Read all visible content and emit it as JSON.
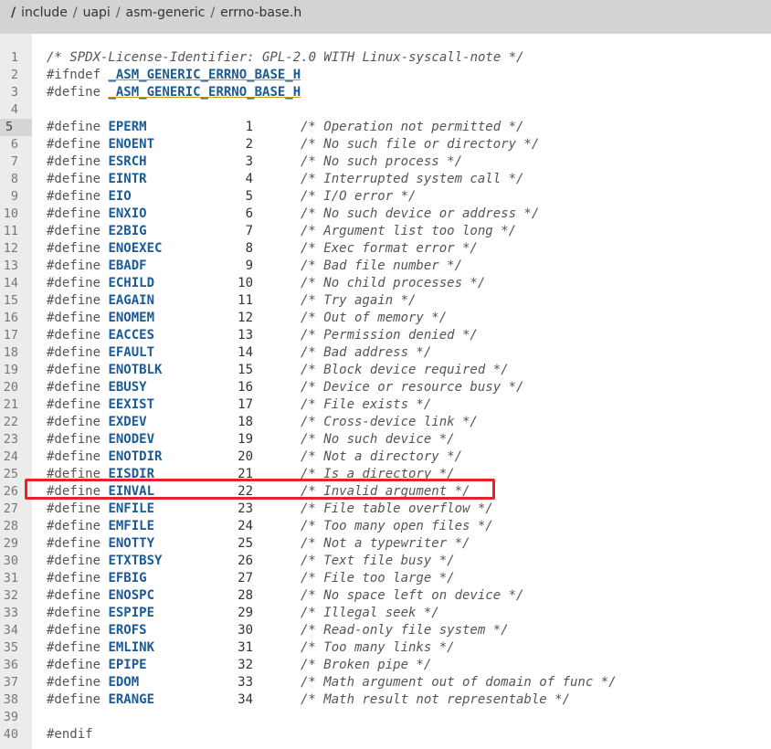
{
  "breadcrumb": {
    "root": "/",
    "items": [
      "include",
      "uapi",
      "asm-generic",
      "errno-base.h"
    ]
  },
  "colors": {
    "topbar": "#d3d3d3",
    "macro": "#1a5a96",
    "highlight_border": "#e8222a"
  },
  "code": {
    "header_lines": [
      {
        "n": "1",
        "text": "/* SPDX-License-Identifier: GPL-2.0 WITH Linux-syscall-note */"
      },
      {
        "n": "2",
        "kw": "#ifndef ",
        "macro": "_ASM_GENERIC_ERRNO_BASE_H"
      },
      {
        "n": "3",
        "kw": "#define ",
        "macro": "_ASM_GENERIC_ERRNO_BASE_H"
      },
      {
        "n": "4"
      }
    ],
    "defines": [
      {
        "n": "5",
        "name": "EPERM",
        "value": "1",
        "comment": "/* Operation not permitted */"
      },
      {
        "n": "6",
        "name": "ENOENT",
        "value": "2",
        "comment": "/* No such file or directory */"
      },
      {
        "n": "7",
        "name": "ESRCH",
        "value": "3",
        "comment": "/* No such process */"
      },
      {
        "n": "8",
        "name": "EINTR",
        "value": "4",
        "comment": "/* Interrupted system call */"
      },
      {
        "n": "9",
        "name": "EIO",
        "value": "5",
        "comment": "/* I/O error */"
      },
      {
        "n": "10",
        "name": "ENXIO",
        "value": "6",
        "comment": "/* No such device or address */"
      },
      {
        "n": "11",
        "name": "E2BIG",
        "value": "7",
        "comment": "/* Argument list too long */"
      },
      {
        "n": "12",
        "name": "ENOEXEC",
        "value": "8",
        "comment": "/* Exec format error */"
      },
      {
        "n": "13",
        "name": "EBADF",
        "value": "9",
        "comment": "/* Bad file number */"
      },
      {
        "n": "14",
        "name": "ECHILD",
        "value": "10",
        "comment": "/* No child processes */"
      },
      {
        "n": "15",
        "name": "EAGAIN",
        "value": "11",
        "comment": "/* Try again */"
      },
      {
        "n": "16",
        "name": "ENOMEM",
        "value": "12",
        "comment": "/* Out of memory */"
      },
      {
        "n": "17",
        "name": "EACCES",
        "value": "13",
        "comment": "/* Permission denied */"
      },
      {
        "n": "18",
        "name": "EFAULT",
        "value": "14",
        "comment": "/* Bad address */"
      },
      {
        "n": "19",
        "name": "ENOTBLK",
        "value": "15",
        "comment": "/* Block device required */"
      },
      {
        "n": "20",
        "name": "EBUSY",
        "value": "16",
        "comment": "/* Device or resource busy */"
      },
      {
        "n": "21",
        "name": "EEXIST",
        "value": "17",
        "comment": "/* File exists */"
      },
      {
        "n": "22",
        "name": "EXDEV",
        "value": "18",
        "comment": "/* Cross-device link */"
      },
      {
        "n": "23",
        "name": "ENODEV",
        "value": "19",
        "comment": "/* No such device */"
      },
      {
        "n": "24",
        "name": "ENOTDIR",
        "value": "20",
        "comment": "/* Not a directory */"
      },
      {
        "n": "25",
        "name": "EISDIR",
        "value": "21",
        "comment": "/* Is a directory */"
      },
      {
        "n": "26",
        "name": "EINVAL",
        "value": "22",
        "comment": "/* Invalid argument */"
      },
      {
        "n": "27",
        "name": "ENFILE",
        "value": "23",
        "comment": "/* File table overflow */"
      },
      {
        "n": "28",
        "name": "EMFILE",
        "value": "24",
        "comment": "/* Too many open files */"
      },
      {
        "n": "29",
        "name": "ENOTTY",
        "value": "25",
        "comment": "/* Not a typewriter */"
      },
      {
        "n": "30",
        "name": "ETXTBSY",
        "value": "26",
        "comment": "/* Text file busy */"
      },
      {
        "n": "31",
        "name": "EFBIG",
        "value": "27",
        "comment": "/* File too large */"
      },
      {
        "n": "32",
        "name": "ENOSPC",
        "value": "28",
        "comment": "/* No space left on device */"
      },
      {
        "n": "33",
        "name": "ESPIPE",
        "value": "29",
        "comment": "/* Illegal seek */"
      },
      {
        "n": "34",
        "name": "EROFS",
        "value": "30",
        "comment": "/* Read-only file system */"
      },
      {
        "n": "35",
        "name": "EMLINK",
        "value": "31",
        "comment": "/* Too many links */"
      },
      {
        "n": "36",
        "name": "EPIPE",
        "value": "32",
        "comment": "/* Broken pipe */"
      },
      {
        "n": "37",
        "name": "EDOM",
        "value": "33",
        "comment": "/* Math argument out of domain of func */"
      },
      {
        "n": "38",
        "name": "ERANGE",
        "value": "34",
        "comment": "/* Math result not representable */"
      }
    ],
    "footer_lines": [
      {
        "n": "39"
      },
      {
        "n": "40",
        "kw": "#endif"
      }
    ],
    "define_keyword": "#define",
    "active_line": "5",
    "highlighted_line": "26"
  }
}
